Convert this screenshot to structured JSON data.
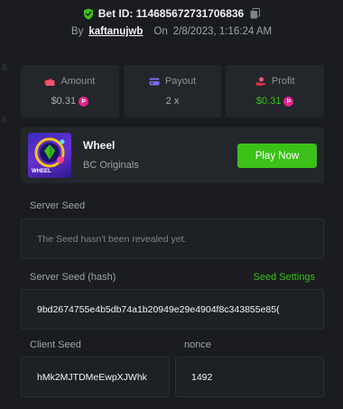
{
  "header": {
    "bet_id": "Bet ID: 114685672731706836",
    "by_label": "By",
    "username": "kaftanujwb",
    "on_label": "On",
    "datetime": "2/8/2023, 1:16:24 AM"
  },
  "stats": [
    {
      "label": "Amount",
      "value": "$0.31",
      "icon": "money-stack-icon",
      "value_color": "#a8adb2"
    },
    {
      "label": "Payout",
      "value": "2 x",
      "icon": "card-icon",
      "value_color": "#a8adb2"
    },
    {
      "label": "Profit",
      "value": "$0.31",
      "icon": "hand-coin-icon",
      "value_color": "#3bc117"
    }
  ],
  "game": {
    "thumb_label": "WHEEL",
    "name": "Wheel",
    "provider": "BC Originals",
    "play_label": "Play Now"
  },
  "server_seed": {
    "label": "Server Seed",
    "value": "The Seed hasn't been revealed yet."
  },
  "server_seed_hash": {
    "label": "Server Seed (hash)",
    "settings_label": "Seed Settings",
    "value": "9bd2674755e4b5db74a1b20949e29e4904f8c343855e85("
  },
  "client_seed": {
    "label": "Client Seed",
    "value": "hMk2MJTDMeEwpXJWhk"
  },
  "nonce": {
    "label": "nonce",
    "value": "1492"
  },
  "colors": {
    "accent_green": "#3bc117",
    "background": "#1a1c1f",
    "card": "#23262a",
    "coin_pink": "#e1218a"
  }
}
